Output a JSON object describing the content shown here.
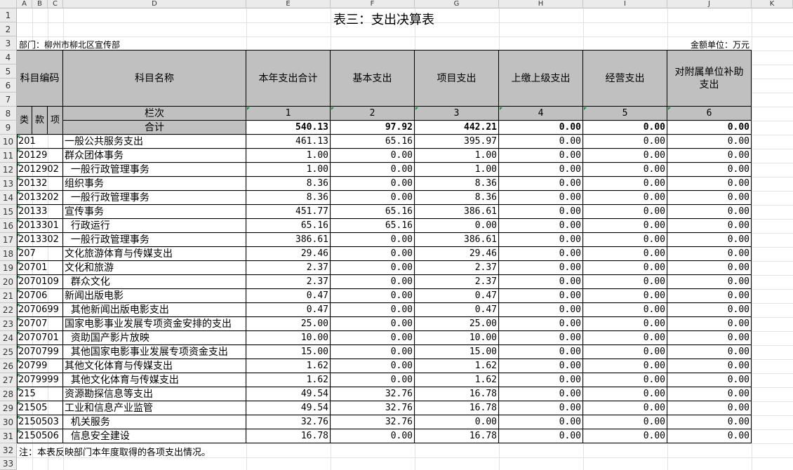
{
  "sheet": {
    "columns": [
      "A",
      "B",
      "C",
      "D",
      "E",
      "F",
      "G",
      "H",
      "I",
      "J",
      "K"
    ],
    "rows": [
      "1",
      "2",
      "3",
      "4",
      "5",
      "6",
      "7",
      "8",
      "9",
      "10",
      "11",
      "12",
      "13",
      "14",
      "15",
      "16",
      "17",
      "18",
      "19",
      "20",
      "21",
      "22",
      "23",
      "24",
      "25",
      "26",
      "27",
      "28",
      "29",
      "30",
      "31",
      "32",
      "33"
    ]
  },
  "report": {
    "title": "表三：支出决算表",
    "department": "部门：柳州市柳北区宣传部",
    "unit": "金额单位：万元",
    "note": "注：本表反映部门本年度取得的各项支出情况。"
  },
  "header": {
    "code": "科目编码",
    "name": "科目名称",
    "lei": "类",
    "kuan": "款",
    "xiang": "项",
    "lanci": "栏次",
    "heji": "合计",
    "columns": [
      {
        "label": "本年支出合计",
        "index": "1"
      },
      {
        "label": "基本支出",
        "index": "2"
      },
      {
        "label": "项目支出",
        "index": "3"
      },
      {
        "label": "上缴上级支出",
        "index": "4"
      },
      {
        "label": "经营支出",
        "index": "5"
      },
      {
        "label": "对附属单位补助支出",
        "index": "6"
      }
    ]
  },
  "totals": [
    "540.13",
    "97.92",
    "442.21",
    "0.00",
    "0.00",
    "0.00"
  ],
  "rows": [
    {
      "code": "201",
      "name": "一般公共服务支出",
      "v": [
        "461.13",
        "65.16",
        "395.97",
        "0.00",
        "0.00",
        "0.00"
      ]
    },
    {
      "code": "20129",
      "name": "群众团体事务",
      "v": [
        "1.00",
        "0.00",
        "1.00",
        "0.00",
        "0.00",
        "0.00"
      ]
    },
    {
      "code": "2012902",
      "name": "  一般行政管理事务",
      "v": [
        "1.00",
        "0.00",
        "1.00",
        "0.00",
        "0.00",
        "0.00"
      ]
    },
    {
      "code": "20132",
      "name": "组织事务",
      "v": [
        "8.36",
        "0.00",
        "8.36",
        "0.00",
        "0.00",
        "0.00"
      ]
    },
    {
      "code": "2013202",
      "name": "  一般行政管理事务",
      "v": [
        "8.36",
        "0.00",
        "8.36",
        "0.00",
        "0.00",
        "0.00"
      ]
    },
    {
      "code": "20133",
      "name": "宣传事务",
      "v": [
        "451.77",
        "65.16",
        "386.61",
        "0.00",
        "0.00",
        "0.00"
      ]
    },
    {
      "code": "2013301",
      "name": "  行政运行",
      "v": [
        "65.16",
        "65.16",
        "0.00",
        "0.00",
        "0.00",
        "0.00"
      ]
    },
    {
      "code": "2013302",
      "name": "  一般行政管理事务",
      "v": [
        "386.61",
        "0.00",
        "386.61",
        "0.00",
        "0.00",
        "0.00"
      ]
    },
    {
      "code": "207",
      "name": "文化旅游体育与传媒支出",
      "v": [
        "29.46",
        "0.00",
        "29.46",
        "0.00",
        "0.00",
        "0.00"
      ]
    },
    {
      "code": "20701",
      "name": "文化和旅游",
      "v": [
        "2.37",
        "0.00",
        "2.37",
        "0.00",
        "0.00",
        "0.00"
      ]
    },
    {
      "code": "2070109",
      "name": "  群众文化",
      "v": [
        "2.37",
        "0.00",
        "2.37",
        "0.00",
        "0.00",
        "0.00"
      ]
    },
    {
      "code": "20706",
      "name": "新闻出版电影",
      "v": [
        "0.47",
        "0.00",
        "0.47",
        "0.00",
        "0.00",
        "0.00"
      ]
    },
    {
      "code": "2070699",
      "name": "  其他新闻出版电影支出",
      "v": [
        "0.47",
        "0.00",
        "0.47",
        "0.00",
        "0.00",
        "0.00"
      ]
    },
    {
      "code": "20707",
      "name": "国家电影事业发展专项资金安排的支出",
      "v": [
        "25.00",
        "0.00",
        "25.00",
        "0.00",
        "0.00",
        "0.00"
      ]
    },
    {
      "code": "2070701",
      "name": "  资助国产影片放映",
      "v": [
        "10.00",
        "0.00",
        "10.00",
        "0.00",
        "0.00",
        "0.00"
      ]
    },
    {
      "code": "2070799",
      "name": "  其他国家电影事业发展专项资金支出",
      "v": [
        "15.00",
        "0.00",
        "15.00",
        "0.00",
        "0.00",
        "0.00"
      ]
    },
    {
      "code": "20799",
      "name": "其他文化体育与传媒支出",
      "v": [
        "1.62",
        "0.00",
        "1.62",
        "0.00",
        "0.00",
        "0.00"
      ]
    },
    {
      "code": "2079999",
      "name": "  其他文化体育与传媒支出",
      "v": [
        "1.62",
        "0.00",
        "1.62",
        "0.00",
        "0.00",
        "0.00"
      ]
    },
    {
      "code": "215",
      "name": "资源勘探信息等支出",
      "v": [
        "49.54",
        "32.76",
        "16.78",
        "0.00",
        "0.00",
        "0.00"
      ]
    },
    {
      "code": "21505",
      "name": "工业和信息产业监管",
      "v": [
        "49.54",
        "32.76",
        "16.78",
        "0.00",
        "0.00",
        "0.00"
      ]
    },
    {
      "code": "2150503",
      "name": "  机关服务",
      "v": [
        "32.76",
        "32.76",
        "0.00",
        "0.00",
        "0.00",
        "0.00"
      ]
    },
    {
      "code": "2150506",
      "name": "  信息安全建设",
      "v": [
        "16.78",
        "0.00",
        "16.78",
        "0.00",
        "0.00",
        "0.00"
      ]
    }
  ]
}
